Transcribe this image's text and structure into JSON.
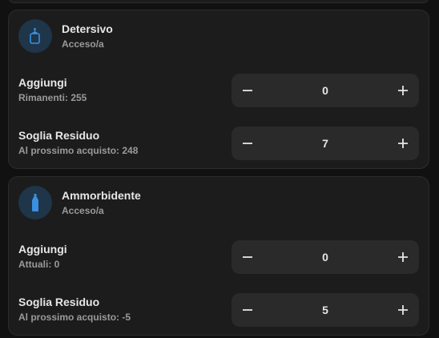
{
  "cards": [
    {
      "title": "Detersivo",
      "status": "Acceso/a",
      "icon": "detergent-bottle-icon",
      "rows": [
        {
          "label": "Aggiungi",
          "sub": "Rimanenti: 255",
          "value": "0"
        },
        {
          "label": "Soglia Residuo",
          "sub": "Al prossimo acquisto: 248",
          "value": "7"
        }
      ]
    },
    {
      "title": "Ammorbidente",
      "status": "Acceso/a",
      "icon": "softener-bottle-icon",
      "rows": [
        {
          "label": "Aggiungi",
          "sub": "Attuali: 0",
          "value": "0"
        },
        {
          "label": "Soglia Residuo",
          "sub": "Al prossimo acquisto: -5",
          "value": "5"
        }
      ]
    }
  ],
  "colors": {
    "background": "#111111",
    "card": "#1c1c1c",
    "stepper": "#2a2a2a",
    "icon_accent": "#3b8fe0",
    "icon_bg": "#1f3549"
  }
}
